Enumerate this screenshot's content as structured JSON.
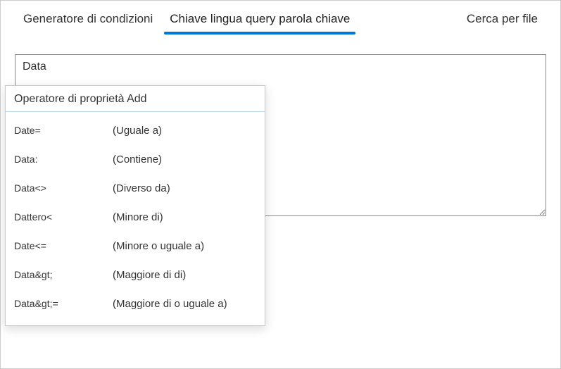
{
  "tabs": {
    "condition_generator": "Generatore di condizioni",
    "kql": "Chiave lingua query parola chiave",
    "search_file": "Cerca per file"
  },
  "query": {
    "value": "Data"
  },
  "dropdown": {
    "header": "Operatore di proprietà Add",
    "items": [
      {
        "key": "Date=",
        "desc": "(Uguale a)"
      },
      {
        "key": "Data:",
        "desc": "(Contiene)"
      },
      {
        "key": "Data<>",
        "desc": "(Diverso da)"
      },
      {
        "key": "Dattero<",
        "desc": "(Minore di)"
      },
      {
        "key": "Date<=",
        "desc": "(Minore o     uguale a)"
      },
      {
        "key": "Data&gt;",
        "desc": "(Maggiore di  di)"
      },
      {
        "key": "Data&gt;=",
        "desc": "(Maggiore di  o uguale a)"
      }
    ]
  }
}
